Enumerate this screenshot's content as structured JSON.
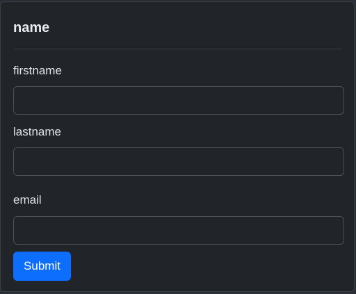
{
  "form": {
    "title": "name",
    "fields": [
      {
        "label": "firstname",
        "value": "",
        "placeholder": ""
      },
      {
        "label": "lastname",
        "value": "",
        "placeholder": ""
      },
      {
        "label": "email",
        "value": "",
        "placeholder": ""
      }
    ],
    "submit_label": "Submit"
  },
  "colors": {
    "background": "#212529",
    "border": "#495057",
    "accent": "#0d6efd"
  }
}
